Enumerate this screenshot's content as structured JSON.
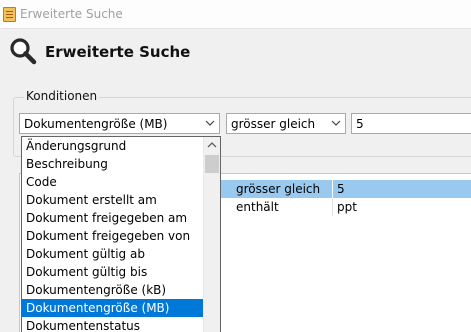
{
  "window": {
    "title": "Erweiterte Suche"
  },
  "header": {
    "title": "Erweiterte Suche"
  },
  "conditions": {
    "group_label": "Konditionen",
    "field_value": "Dokumentengröße (MB)",
    "operator_value": "grösser gleich",
    "value_input": "5"
  },
  "dropdown": {
    "items": [
      "Änderungsgrund",
      "Beschreibung",
      "Code",
      "Dokument erstellt am",
      "Dokument freigegeben am",
      "Dokument freigegeben von",
      "Dokument gültig ab",
      "Dokument gültig bis",
      "Dokumentengröße (kB)",
      "Dokumentengröße (MB)",
      "Dokumentenstatus"
    ],
    "selected": "Dokumentengröße (MB)"
  },
  "table": {
    "rows": [
      {
        "operator": "grösser gleich",
        "value": "5",
        "selected": true
      },
      {
        "operator": "enthält",
        "value": "ppt",
        "selected": false
      }
    ]
  },
  "colors": {
    "selection_blue": "#0078d7",
    "row_selection": "#99c9ef"
  }
}
